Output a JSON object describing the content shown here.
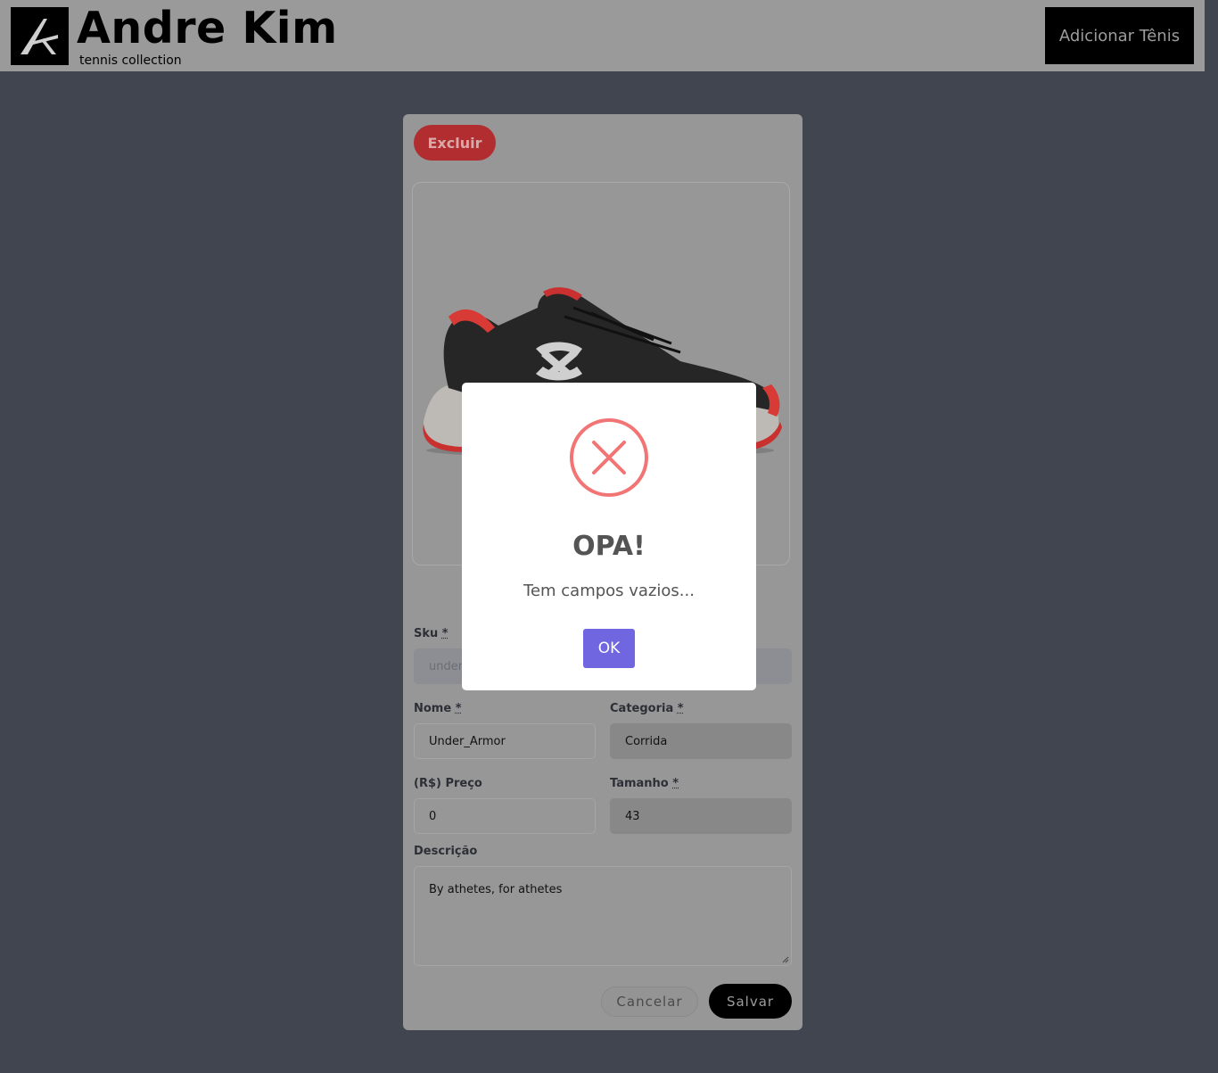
{
  "header": {
    "brand_title": "Andre Kim",
    "brand_subtitle": "tennis collection",
    "logo_icon": "ak-logo-icon",
    "add_button": "Adicionar Tênis"
  },
  "card": {
    "delete_button": "Excluir",
    "image_alt": "Under Armour running shoe",
    "fields": {
      "sku": {
        "label": "Sku",
        "required_mark": "*",
        "value": "under_"
      },
      "nome": {
        "label": "Nome",
        "required_mark": "*",
        "value": "Under_Armor"
      },
      "categoria": {
        "label": "Categoria",
        "required_mark": "*",
        "value": "Corrida"
      },
      "preco": {
        "label": "(R$) Preço",
        "value": "0"
      },
      "tamanho": {
        "label": "Tamanho",
        "required_mark": "*",
        "value": "43"
      },
      "descricao": {
        "label": "Descrição",
        "value": "By athetes, for athetes"
      }
    },
    "cancel_button": "Cancelar",
    "save_button": "Salvar"
  },
  "modal": {
    "icon": "error-x-icon",
    "title": "OPA!",
    "text": "Tem campos vazios...",
    "ok_button": "OK"
  },
  "colors": {
    "overlay_bg": "#414550",
    "delete": "#b22d2f",
    "error_icon": "#f27474",
    "ok_button": "#7066e0"
  }
}
